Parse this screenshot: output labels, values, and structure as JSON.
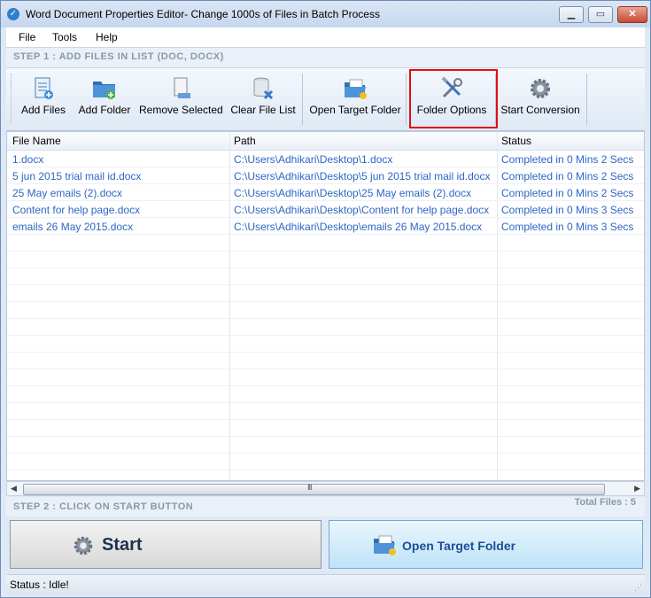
{
  "window": {
    "title": "Word Document Properties Editor- Change 1000s of Files in Batch Process"
  },
  "menu": [
    "File",
    "Tools",
    "Help"
  ],
  "step1": "STEP 1 : ADD FILES IN LIST (DOC, DOCX)",
  "toolbar": {
    "add_files": "Add Files",
    "add_folder": "Add Folder",
    "remove_selected": "Remove Selected",
    "clear_file_list": "Clear File List",
    "open_target_folder": "Open Target Folder",
    "folder_options": "Folder Options",
    "start_conversion": "Start Conversion"
  },
  "grid": {
    "columns": [
      "File Name",
      "Path",
      "Status"
    ],
    "rows": [
      [
        "1.docx",
        "C:\\Users\\Adhikari\\Desktop\\1.docx",
        "Completed in 0 Mins 2 Secs"
      ],
      [
        "5 jun 2015 trial mail id.docx",
        "C:\\Users\\Adhikari\\Desktop\\5 jun 2015 trial mail id.docx",
        "Completed in 0 Mins 2 Secs"
      ],
      [
        "25 May emails (2).docx",
        "C:\\Users\\Adhikari\\Desktop\\25 May emails (2).docx",
        "Completed in 0 Mins 2 Secs"
      ],
      [
        "Content for help page.docx",
        "C:\\Users\\Adhikari\\Desktop\\Content for help page.docx",
        "Completed in 0 Mins 3 Secs"
      ],
      [
        "emails 26 May 2015.docx",
        "C:\\Users\\Adhikari\\Desktop\\emails 26 May 2015.docx",
        "Completed in 0 Mins 3 Secs"
      ]
    ]
  },
  "scroll": {
    "grip": "III"
  },
  "step2": "STEP 2 : CLICK ON START BUTTON",
  "total_files": "Total Files : 5",
  "buttons": {
    "start": "Start",
    "open_target_folder": "Open Target Folder"
  },
  "status": "Status  :  Idle!",
  "colors": {
    "link_text": "#2e66c4",
    "highlight": "#e01010",
    "title_bar": "#c5d7ee"
  }
}
